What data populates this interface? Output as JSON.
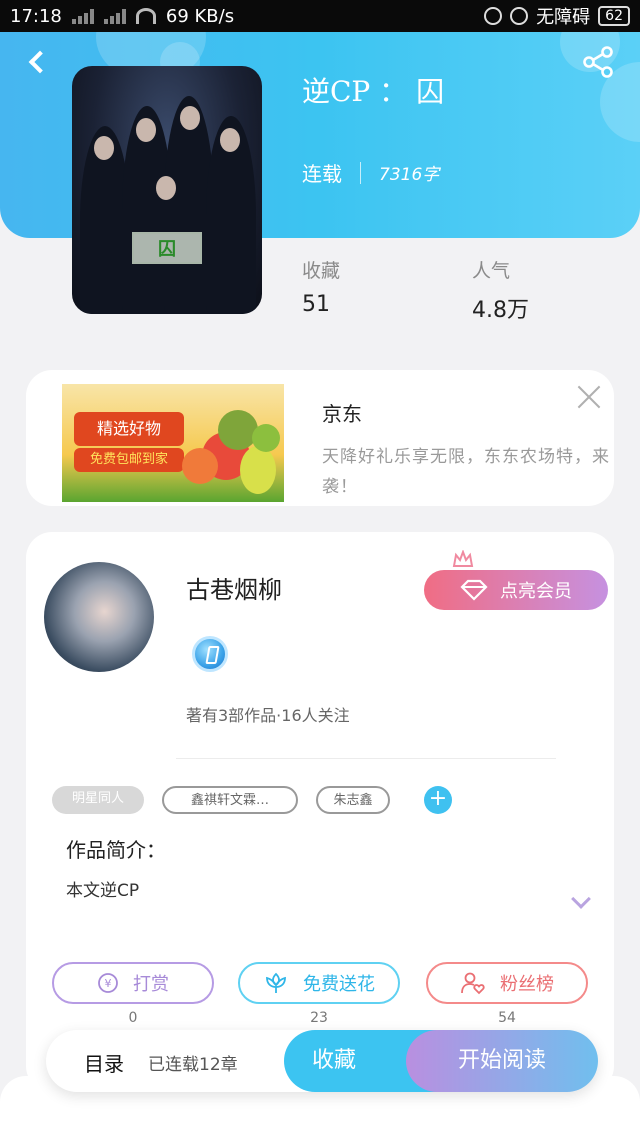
{
  "status_bar": {
    "time": "17:18",
    "speed": "69 KB/s",
    "accessibility": "无障碍",
    "battery": "62"
  },
  "header": {
    "title": "逆CP ： 囚",
    "serial_status": "连载",
    "word_count": "7316字",
    "cover_tag": "囚",
    "back_icon": "chevron-left-icon",
    "share_icon": "share-icon"
  },
  "stats": {
    "favorites_label": "收藏",
    "favorites_value": "51",
    "popularity_label": "人气",
    "popularity_value": "4.8万"
  },
  "ad": {
    "brand": "京东",
    "description": "天降好礼乐享无限，东东农场特，来袭！",
    "image_text_1": "精选好物",
    "image_text_2": "免费包邮到家",
    "close_icon": "close-icon"
  },
  "author": {
    "name": "古巷烟柳",
    "member_button": "点亮会员",
    "stats_text": "著有3部作品·16人关注",
    "tags": [
      "明星同人",
      "鑫祺轩文霖…",
      "朱志鑫"
    ],
    "add_tag": "+"
  },
  "intro": {
    "heading": "作品简介：",
    "body": "本文逆CP"
  },
  "actions": [
    {
      "label": "打赏",
      "count": "0",
      "icon": "yen-coin-icon"
    },
    {
      "label": "免费送花",
      "count": "23",
      "icon": "flower-icon"
    },
    {
      "label": "粉丝榜",
      "count": "54",
      "icon": "fan-heart-icon"
    }
  ],
  "bottom_bar": {
    "toc_label": "目录",
    "chapters": "已连载12章",
    "favorite_button": "收藏",
    "read_button": "开始阅读"
  },
  "colors": {
    "header_blue": "#3cc4f1",
    "member_gradient_start": "#f06d84",
    "member_gradient_end": "#c691e0",
    "read_gradient_start": "#b98fe0",
    "read_gradient_end": "#70bfee"
  }
}
